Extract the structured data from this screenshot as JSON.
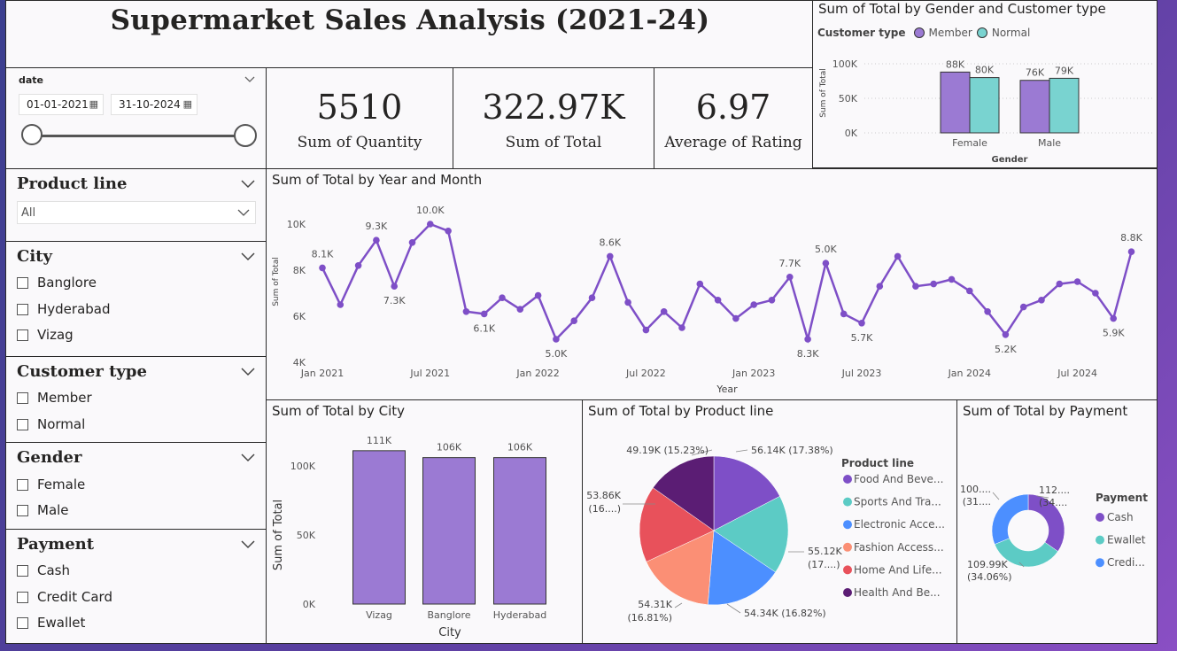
{
  "title": "Supermarket Sales Analysis (2021-24)",
  "colors": {
    "purple": "#7e4fc7",
    "bar": "#9b7ad3",
    "teal": "#79d3d0",
    "blue": "#4c8fff",
    "salmon": "#fb8f75",
    "red": "#e8515b",
    "darkpurple": "#5b1d74",
    "teal2": "#5ccbc5"
  },
  "date_slicer": {
    "label": "date",
    "start": "01-01-2021",
    "end": "31-10-2024"
  },
  "kpis": [
    {
      "value": "5510",
      "label": "Sum of Quantity"
    },
    {
      "value": "322.97K",
      "label": "Sum of Total"
    },
    {
      "value": "6.97",
      "label": "Average of Rating"
    }
  ],
  "slicers": {
    "product_line": {
      "title": "Product line",
      "selected": "All"
    },
    "city": {
      "title": "City",
      "items": [
        "Banglore",
        "Hyderabad",
        "Vizag"
      ]
    },
    "customer_type": {
      "title": "Customer type",
      "items": [
        "Member",
        "Normal"
      ]
    },
    "gender": {
      "title": "Gender",
      "items": [
        "Female",
        "Male"
      ]
    },
    "payment": {
      "title": "Payment",
      "items": [
        "Cash",
        "Credit Card",
        "Ewallet"
      ]
    }
  },
  "gender_chart": {
    "title": "Sum of Total by Gender and Customer type",
    "legend_title": "Customer type",
    "legend": [
      "Member",
      "Normal"
    ],
    "ylabel": "Sum of Total",
    "xlabel": "Gender",
    "yticks": [
      "100K",
      "50K",
      "0K"
    ]
  },
  "line_chart": {
    "title": "Sum of Total by Year and Month",
    "xlabel": "Year",
    "ylabel": "Sum of Total",
    "yticks": [
      "10K",
      "8K",
      "6K",
      "4K"
    ],
    "xticks": [
      "Jan 2021",
      "Jul 2021",
      "Jan 2022",
      "Jul 2022",
      "Jan 2023",
      "Jul 2023",
      "Jan 2024",
      "Jul 2024"
    ],
    "labels": [
      "8.1K",
      "9.3K",
      "7.3K",
      "10.0K",
      "6.1K",
      "5.0K",
      "8.6K",
      "7.7K",
      "8.3K",
      "5.0K",
      "5.7K",
      "5.2K",
      "5.9K",
      "8.8K"
    ]
  },
  "city_chart": {
    "title": "Sum of Total by City",
    "xlabel": "City",
    "ylabel": "Sum of Total",
    "yticks": [
      "100K",
      "50K",
      "0K"
    ]
  },
  "product_chart": {
    "title": "Sum of Total by Product line",
    "legend_title": "Product line",
    "legend": [
      "Food And Beve...",
      "Sports And Tra...",
      "Electronic Acce...",
      "Fashion Access...",
      "Home And Life...",
      "Health And Be..."
    ],
    "labels": [
      {
        "l1": "56.14K (17.38%)",
        "l2": ""
      },
      {
        "l1": "55.12K",
        "l2": "(17....)"
      },
      {
        "l1": "54.34K (16.82%)",
        "l2": ""
      },
      {
        "l1": "54.31K",
        "l2": "(16.81%)"
      },
      {
        "l1": "53.86K",
        "l2": "(16....)"
      },
      {
        "l1": "49.19K (15.23%)",
        "l2": ""
      }
    ]
  },
  "payment_chart": {
    "title": "Sum of Total by Payment",
    "legend_title": "Payment",
    "legend": [
      "Cash",
      "Ewallet",
      "Credi..."
    ],
    "labels": [
      {
        "l1": "112....",
        "l2": "(34...."
      },
      {
        "l1": "109.99K",
        "l2": "(34.06%)"
      },
      {
        "l1": "100....",
        "l2": "(31...."
      }
    ]
  },
  "chart_data": [
    {
      "type": "bar",
      "title": "Sum of Total by Gender and Customer type",
      "categories": [
        "Female",
        "Male"
      ],
      "series": [
        {
          "name": "Member",
          "values": [
            88,
            76
          ],
          "labels": [
            "88K",
            "76K"
          ]
        },
        {
          "name": "Normal",
          "values": [
            80,
            79
          ],
          "labels": [
            "80K",
            "79K"
          ]
        }
      ],
      "xlabel": "Gender",
      "ylabel": "Sum of Total",
      "ylim": [
        0,
        115
      ]
    },
    {
      "type": "line",
      "title": "Sum of Total by Year and Month",
      "x": [
        "2021-01",
        "2021-02",
        "2021-03",
        "2021-04",
        "2021-05",
        "2021-06",
        "2021-07",
        "2021-08",
        "2021-09",
        "2021-10",
        "2021-11",
        "2021-12",
        "2022-01",
        "2022-02",
        "2022-03",
        "2022-04",
        "2022-05",
        "2022-06",
        "2022-07",
        "2022-08",
        "2022-09",
        "2022-10",
        "2022-11",
        "2022-12",
        "2023-01",
        "2023-02",
        "2023-03",
        "2023-04",
        "2023-05",
        "2023-06",
        "2023-07",
        "2023-08",
        "2023-09",
        "2023-10",
        "2023-11",
        "2023-12",
        "2024-01",
        "2024-02",
        "2024-03",
        "2024-04",
        "2024-05",
        "2024-06",
        "2024-07",
        "2024-08",
        "2024-09",
        "2024-10"
      ],
      "values": [
        8.1,
        6.5,
        8.2,
        9.3,
        7.3,
        9.2,
        10.0,
        9.7,
        6.2,
        6.1,
        6.8,
        6.3,
        6.9,
        5.0,
        5.8,
        6.8,
        8.6,
        6.6,
        5.4,
        6.2,
        5.5,
        7.4,
        6.7,
        5.9,
        6.5,
        6.7,
        7.7,
        5.0,
        8.3,
        6.1,
        5.7,
        7.3,
        8.6,
        7.3,
        7.4,
        7.6,
        7.1,
        6.2,
        5.2,
        6.4,
        6.7,
        7.4,
        7.5,
        7.0,
        5.9,
        8.8
      ],
      "xlabel": "Year",
      "ylabel": "Sum of Total",
      "ylim": [
        4,
        10.6
      ]
    },
    {
      "type": "bar",
      "title": "Sum of Total by City",
      "categories": [
        "Vizag",
        "Banglore",
        "Hyderabad"
      ],
      "values": [
        111,
        106,
        106
      ],
      "labels": [
        "111K",
        "106K",
        "106K"
      ],
      "xlabel": "City",
      "ylabel": "Sum of Total",
      "ylim": [
        0,
        125
      ]
    },
    {
      "type": "pie",
      "title": "Sum of Total by Product line",
      "categories": [
        "Food And Beverages",
        "Sports And Travel",
        "Electronic Accessories",
        "Fashion Accessories",
        "Home And Lifestyle",
        "Health And Beauty"
      ],
      "values": [
        56.14,
        55.12,
        54.34,
        54.31,
        53.86,
        49.19
      ],
      "colors": [
        "#7e4fc7",
        "#5ccbc5",
        "#4c8fff",
        "#fb8f75",
        "#e8515b",
        "#5b1d74"
      ]
    },
    {
      "type": "pie",
      "title": "Sum of Total by Payment",
      "categories": [
        "Cash",
        "Ewallet",
        "Credit Card"
      ],
      "values": [
        112.21,
        109.99,
        100.77
      ],
      "colors": [
        "#7e4fc7",
        "#5ccbc5",
        "#4c8fff"
      ]
    }
  ]
}
